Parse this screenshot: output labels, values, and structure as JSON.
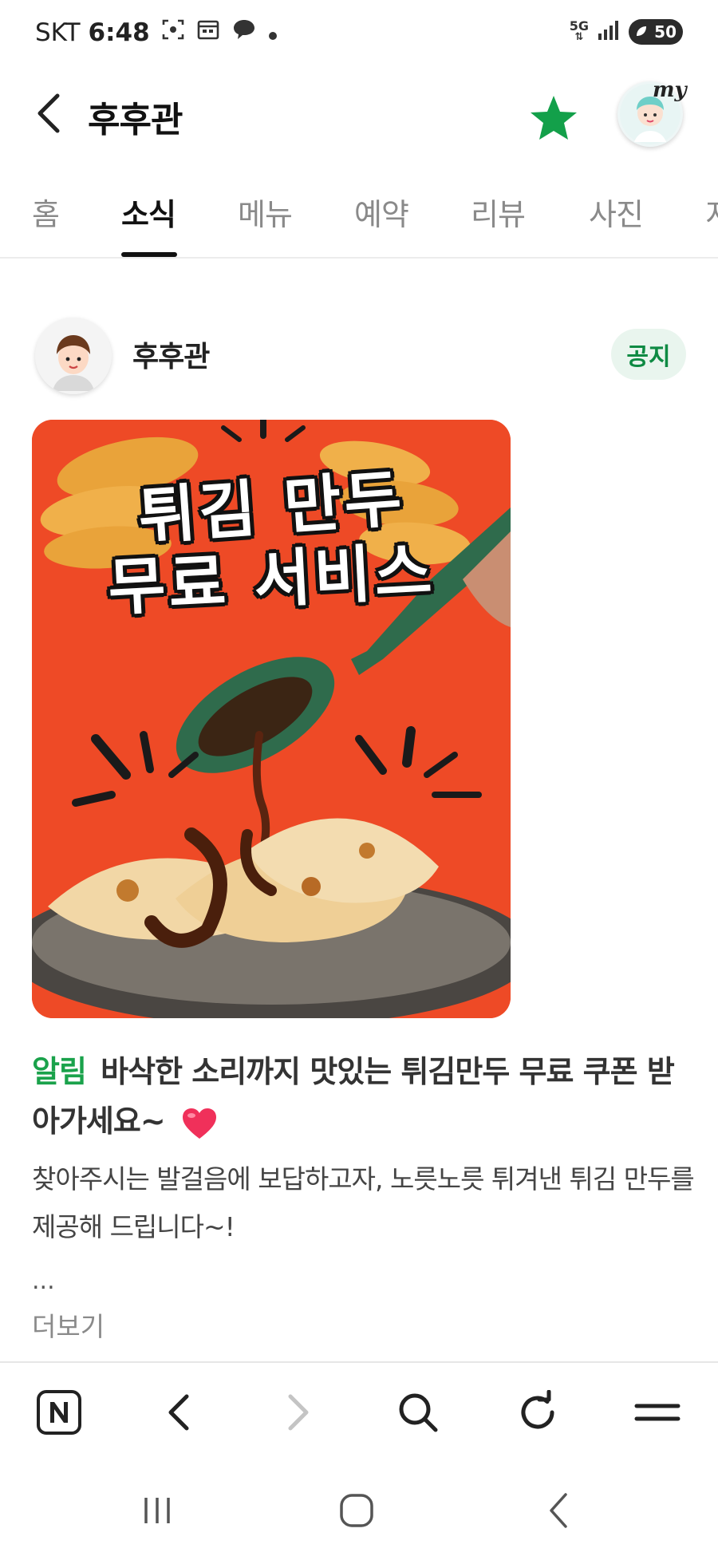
{
  "status_bar": {
    "carrier": "SKT",
    "time": "6:48",
    "network": "5G",
    "battery": "50"
  },
  "header": {
    "title": "후후관",
    "my_label": "my"
  },
  "tabs": [
    {
      "label": "홈",
      "active": false
    },
    {
      "label": "소식",
      "active": true
    },
    {
      "label": "메뉴",
      "active": false
    },
    {
      "label": "예약",
      "active": false
    },
    {
      "label": "리뷰",
      "active": false
    },
    {
      "label": "사진",
      "active": false
    },
    {
      "label": "지",
      "active": false
    }
  ],
  "post": {
    "author": "후후관",
    "badge": "공지",
    "image_text_line1": "튀김 만두",
    "image_text_line2": "무료 서비스",
    "tag": "알림",
    "title": "바삭한 소리까지 맛있는 튀김만두 무료 쿠폰 받아가세요~",
    "body": "찾아주시는 발걸음에 보답하고자, 노릇노릇 튀겨낸 튀김 만두를 제공해 드립니다~!",
    "ellipsis": "...",
    "more": "더보기"
  },
  "colors": {
    "accent_green": "#1aa24b",
    "star_green": "#13a04a",
    "promo_bg": "#ee4a26"
  },
  "browser_bar": [
    "naver-n-icon",
    "back-arrow-icon",
    "forward-arrow-icon",
    "search-icon",
    "refresh-icon",
    "menu-icon"
  ],
  "system_nav": [
    "recent-apps-icon",
    "home-icon",
    "back-icon"
  ]
}
